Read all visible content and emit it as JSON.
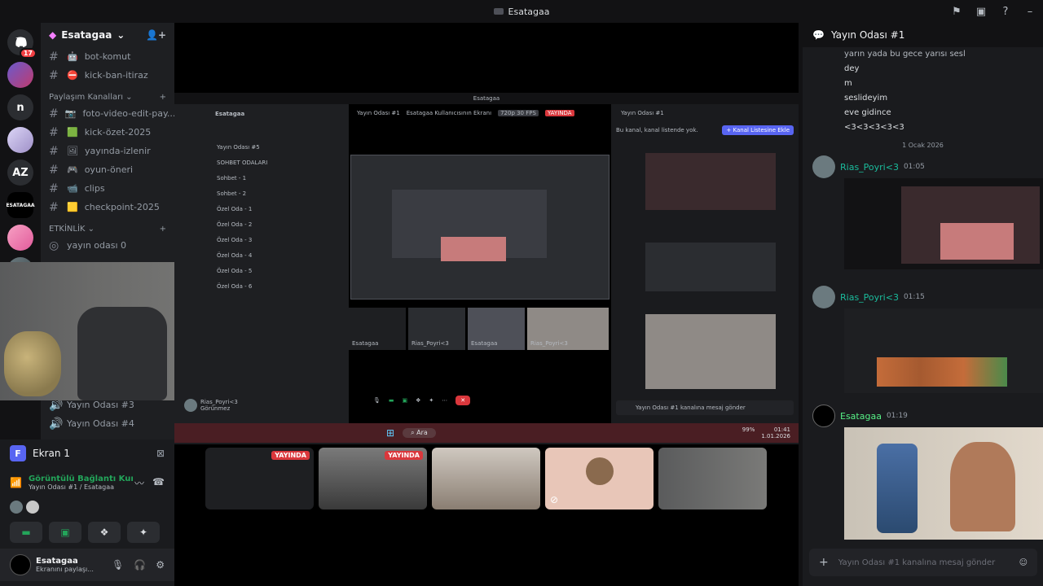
{
  "window": {
    "title": "Esatagaa"
  },
  "rail": {
    "badge_count": "17",
    "servers": [
      "n",
      "AZ"
    ]
  },
  "sidebar": {
    "guild_name": "Esatagaa",
    "channels_top": [
      {
        "name": "bot-komut",
        "emoji": "🤖"
      },
      {
        "name": "kick-ban-itiraz",
        "emoji": "⛔"
      }
    ],
    "category_share": "Paylaşım Kanalları",
    "channels_share": [
      {
        "name": "foto-video-edit-pay...",
        "emoji": "📷"
      },
      {
        "name": "kick-özet-2025",
        "emoji": "🟩"
      },
      {
        "name": "yayında-izlenir",
        "emoji": "🖼"
      },
      {
        "name": "oyun-öneri",
        "emoji": "🎮"
      },
      {
        "name": "clips",
        "emoji": "📹"
      },
      {
        "name": "checkpoint-2025",
        "emoji": "🟨"
      }
    ],
    "category_events": "ETKİNLİK",
    "events_channel": "yayın odası 0",
    "voice_channels": [
      "Yayın Odası #3",
      "Yayın Odası #4"
    ]
  },
  "voicepanel": {
    "screen_label": "Ekran 1",
    "connection_status": "Görüntülü Bağlantı Kuı",
    "connection_sub": "Yayın Odası #1 / Esatagaa",
    "user_name": "Esatagaa",
    "user_status": "Ekranını paylaşı..."
  },
  "stream": {
    "inner_title": "Esatagaa",
    "inner_guild": "Esatagaa",
    "inner_voice_title": "Yayın Odası #1",
    "inner_screen_title": "Esatagaa Kullanıcısının Ekranı",
    "inner_quality": "720p 30 FPS",
    "live_label": "YAYINDA",
    "inner_sidebar": [
      "Yayın Odası #5",
      "SOHBET ODALARI",
      "Sohbet - 1",
      "Sohbet - 2",
      "Özel Oda - 1",
      "Özel Oda - 2",
      "Özel Oda - 3",
      "Özel Oda - 4",
      "Özel Oda - 5",
      "Özel Oda - 6"
    ],
    "inner_user": "Rias_Poyri<3",
    "inner_user_status": "Görünmez",
    "inner_chat_title": "Yayın Odası #1",
    "inner_chat_notice": "Bu kanal, kanal listende yok.",
    "inner_chat_button": "+ Kanal Listesine Ekle",
    "inner_chat_input": "Yayın Odası #1 kanalına mesaj gönder",
    "tile_names": [
      "Esatagaa",
      "Rias_Poyri<3",
      "Esatagaa",
      "Rias_Poyri<3"
    ],
    "taskbar_search": "Ara",
    "taskbar_time": "01:41",
    "taskbar_date": "1.01.2026",
    "taskbar_battery": "99%"
  },
  "chat": {
    "title": "Yayın Odası #1",
    "lines": [
      "yarın yada bu gece yarısı sesl",
      "dey",
      "m",
      "seslideyim",
      "eve gidince",
      "<3<3<3<3<3"
    ],
    "date_divider": "1 Ocak 2026",
    "messages": [
      {
        "user": "Rias_Poyri<3",
        "time": "01:05"
      },
      {
        "user": "Rias_Poyri<3",
        "time": "01:15"
      },
      {
        "user": "Esatagaa",
        "time": "01:19"
      }
    ],
    "input_placeholder": "Yayın Odası #1 kanalına mesaj gönder"
  }
}
